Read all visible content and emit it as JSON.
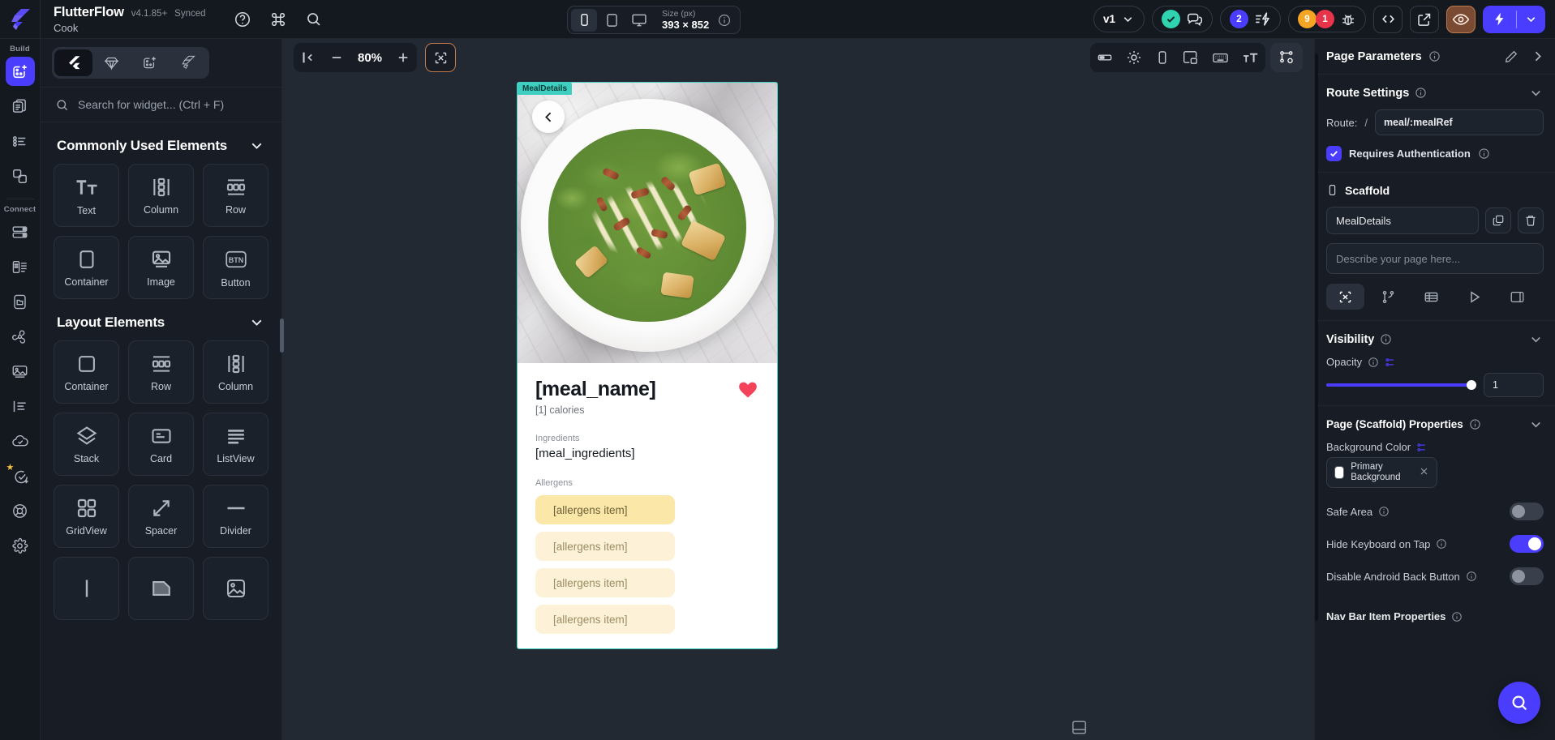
{
  "topbar": {
    "logo_icon": "flutterflow-logo-icon",
    "app_title": "FlutterFlow",
    "version": "v4.1.85+",
    "sync_status": "Synced",
    "project_name": "Cook",
    "help_icon": "help-circle-icon",
    "command_icon": "command-palette-icon",
    "search_icon": "search-icon",
    "device": {
      "phone_icon": "phone-device-icon",
      "tablet_icon": "tablet-device-icon",
      "desktop_icon": "desktop-device-icon",
      "size_label": "Size (px)",
      "size_value": "393 × 852",
      "info_icon": "info-icon"
    },
    "branch": {
      "label": "v1",
      "chevron_icon": "chevron-down-icon"
    },
    "status": {
      "check_icon": "check-circle-icon",
      "comments_icon": "comments-icon"
    },
    "issues": {
      "count": "2",
      "icon": "lightning-list-icon"
    },
    "diagnostics": {
      "warnings": "9",
      "errors": "1",
      "bug_icon": "bug-icon"
    },
    "code_icon": "code-brackets-icon",
    "share_icon": "open-external-icon",
    "preview_icon": "eye-preview-icon",
    "run": {
      "bolt_icon": "lightning-bolt-icon",
      "chevron_icon": "chevron-down-icon"
    }
  },
  "rail": {
    "build_label": "Build",
    "connect_label": "Connect",
    "build_items": [
      {
        "name": "widget-palette",
        "icon": "add-widget-icon",
        "active": true
      },
      {
        "name": "page-selector",
        "icon": "pages-icon",
        "active": false
      },
      {
        "name": "widget-tree",
        "icon": "widget-tree-icon",
        "active": false
      },
      {
        "name": "components",
        "icon": "components-icon",
        "active": false
      }
    ],
    "connect_items": [
      {
        "name": "firestore",
        "icon": "database-icon"
      },
      {
        "name": "app-state",
        "icon": "app-state-icon"
      },
      {
        "name": "local-storage",
        "icon": "device-folder-icon"
      },
      {
        "name": "api-calls",
        "icon": "api-integration-icon"
      },
      {
        "name": "media-assets",
        "icon": "media-image-icon"
      },
      {
        "name": "theme-text",
        "icon": "text-styles-icon"
      },
      {
        "name": "cloud-functions",
        "icon": "cloud-check-icon"
      },
      {
        "name": "tests",
        "icon": "tests-star-icon"
      },
      {
        "name": "deploy",
        "icon": "lifebuoy-icon"
      },
      {
        "name": "settings",
        "icon": "gear-icon"
      }
    ]
  },
  "widget_panel": {
    "tabs": [
      {
        "name": "flutter-widgets",
        "icon": "flutter-icon",
        "active": true
      },
      {
        "name": "ui-kits",
        "icon": "diamond-icon",
        "active": false
      },
      {
        "name": "custom-widgets",
        "icon": "add-widget-icon",
        "active": false
      },
      {
        "name": "flutterflow-marketplace",
        "icon": "flutterflow-logo-icon",
        "active": false
      }
    ],
    "search": {
      "icon": "search-icon",
      "placeholder": "Search for widget...  (Ctrl + F)"
    },
    "sections": [
      {
        "title": "Commonly Used Elements",
        "chevron": "chevron-down-icon",
        "items": [
          {
            "label": "Text",
            "icon": "text-icon"
          },
          {
            "label": "Column",
            "icon": "column-icon"
          },
          {
            "label": "Row",
            "icon": "row-icon"
          },
          {
            "label": "Container",
            "icon": "container-icon"
          },
          {
            "label": "Image",
            "icon": "image-icon"
          },
          {
            "label": "Button",
            "icon": "button-icon"
          }
        ]
      },
      {
        "title": "Layout Elements",
        "chevron": "chevron-down-icon",
        "items": [
          {
            "label": "Container",
            "icon": "container-icon"
          },
          {
            "label": "Row",
            "icon": "row-icon"
          },
          {
            "label": "Column",
            "icon": "column-icon"
          },
          {
            "label": "Stack",
            "icon": "stack-icon"
          },
          {
            "label": "Card",
            "icon": "card-icon"
          },
          {
            "label": "ListView",
            "icon": "listview-icon"
          },
          {
            "label": "GridView",
            "icon": "gridview-icon"
          },
          {
            "label": "Spacer",
            "icon": "spacer-icon"
          },
          {
            "label": "Divider",
            "icon": "divider-icon"
          }
        ]
      }
    ]
  },
  "canvas_toolbar": {
    "collapse_icon": "collapse-panel-icon",
    "zoom_out_icon": "minus-icon",
    "zoom_value": "80%",
    "zoom_in_icon": "plus-icon",
    "select_tool_icon": "selection-tool-icon",
    "right_tools": [
      {
        "name": "status-bar-toggle",
        "icon": "status-bar-icon"
      },
      {
        "name": "theme-brightness",
        "icon": "brightness-icon"
      },
      {
        "name": "device-frame",
        "icon": "phone-device-icon"
      },
      {
        "name": "responsive-preview",
        "icon": "responsive-layout-icon"
      },
      {
        "name": "keyboard-toggle",
        "icon": "keyboard-icon"
      },
      {
        "name": "text-scale",
        "icon": "text-scale-icon"
      }
    ],
    "widget-settings": {
      "name": "widget-settings",
      "icon": "node-settings-icon"
    }
  },
  "preview": {
    "page_tag": "MealDetails",
    "back_icon": "chevron-left-icon",
    "meal_name": "[meal_name]",
    "favorite_icon": "heart-filled-icon",
    "calories": "[1] calories",
    "ingredients_label": "Ingredients",
    "ingredients_value": "[meal_ingredients]",
    "allergens_label": "Allergens",
    "allergens": [
      "[allergens item]",
      "[allergens item]",
      "[allergens item]",
      "[allergens item]"
    ],
    "bottom_icon": "bottom-sheet-icon"
  },
  "right_panel": {
    "header": {
      "title": "Page Parameters",
      "info_icon": "info-icon",
      "edit_icon": "pencil-edit-icon",
      "expand_icon": "chevron-right-icon"
    },
    "route_settings": {
      "title": "Route Settings",
      "info_icon": "info-icon",
      "chevron": "chevron-down-icon",
      "route_label": "Route:",
      "route_slash": "/",
      "route_value": "meal/:mealRef",
      "requires_auth_label": "Requires Authentication",
      "requires_auth_checked": true,
      "auth_info_icon": "info-icon"
    },
    "scaffold": {
      "icon": "phone-device-icon",
      "title": "Scaffold",
      "name_value": "MealDetails",
      "copy_icon": "duplicate-icon",
      "delete_icon": "trash-icon",
      "description_placeholder": "Describe your page here...",
      "tabs": [
        {
          "name": "properties-tab",
          "icon": "tools-icon",
          "active": true
        },
        {
          "name": "actions-tab",
          "icon": "actions-flow-icon",
          "active": false
        },
        {
          "name": "backend-query-tab",
          "icon": "database-rows-icon",
          "active": false
        },
        {
          "name": "animations-tab",
          "icon": "play-icon",
          "active": false
        },
        {
          "name": "state-tab",
          "icon": "state-panel-icon",
          "active": false
        }
      ]
    },
    "visibility": {
      "title": "Visibility",
      "info_icon": "info-icon",
      "chevron": "chevron-down-icon",
      "opacity_label": "Opacity",
      "opacity_info_icon": "info-icon",
      "opacity_var_icon": "set-variable-icon",
      "opacity_value": "1"
    },
    "scaffold_props": {
      "title": "Page (Scaffold) Properties",
      "info_icon": "info-icon",
      "chevron": "chevron-down-icon",
      "background_color_label": "Background Color",
      "background_color_var_icon": "set-variable-icon",
      "background_color_name": "Primary Background",
      "background_color_hex": "#FFFFFF",
      "clear_icon": "close-icon",
      "safe_area_label": "Safe Area",
      "safe_area_info_icon": "info-icon",
      "safe_area_on": false,
      "hide_keyboard_label": "Hide Keyboard on Tap",
      "hide_keyboard_info_icon": "info-icon",
      "hide_keyboard_on": true,
      "disable_back_label": "Disable Android Back Button",
      "disable_back_info_icon": "info-icon",
      "disable_back_on": false,
      "nav_bar_label": "Nav Bar Item Properties",
      "nav_bar_info_icon": "info-icon"
    },
    "fab": {
      "name": "search-fab",
      "icon": "search-icon"
    }
  },
  "colors": {
    "accent": "#4B3DFD",
    "teal": "#2FD3B0",
    "amber": "#F5A524",
    "red": "#E8344A",
    "panel": "#181D25",
    "canvas": "#232933",
    "allergen_active": "#FBE7A8",
    "allergen_idle": "#FDF2D7"
  }
}
